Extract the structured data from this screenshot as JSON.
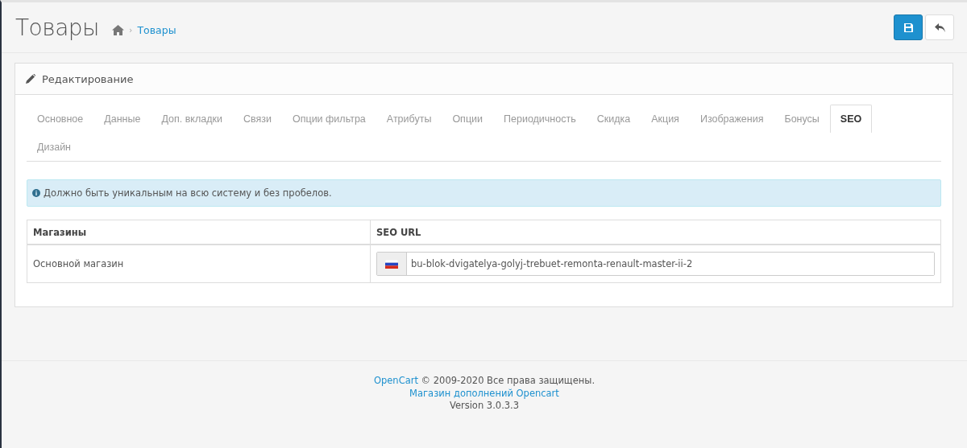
{
  "page": {
    "title": "Товары",
    "breadcrumb": [
      {
        "kind": "home"
      },
      {
        "kind": "link",
        "separator": "›",
        "label": "Товары"
      }
    ]
  },
  "actions": [
    {
      "kind": "save"
    },
    {
      "kind": "back"
    }
  ],
  "panel": {
    "title": "Редактирование",
    "tabs": [
      {
        "label": "Основное",
        "selected": false
      },
      {
        "label": "Данные",
        "selected": false
      },
      {
        "label": "Доп. вкладки",
        "selected": false
      },
      {
        "label": "Связи",
        "selected": false
      },
      {
        "label": "Опции фильтра",
        "selected": false
      },
      {
        "label": "Атрибуты",
        "selected": false
      },
      {
        "label": "Опции",
        "selected": false
      },
      {
        "label": "Периодичность",
        "selected": false
      },
      {
        "label": "Скидка",
        "selected": false
      },
      {
        "label": "Акция",
        "selected": false
      },
      {
        "label": "Изображения",
        "selected": false
      },
      {
        "label": "Бонусы",
        "selected": false
      },
      {
        "label": "SEO",
        "selected": true
      },
      {
        "label": "Дизайн",
        "selected": false
      }
    ],
    "alert": "Должно быть уникальным на всю систему и без пробелов.",
    "table": {
      "columns": [
        "Магазины",
        "SEO URL"
      ],
      "rows": [
        {
          "store": "Основной магазин",
          "seo_url": "bu-blok-dvigatelya-golyj-trebuet-remonta-renault-master-ii-2"
        }
      ]
    }
  },
  "footer": {
    "link": "OpenCart",
    "copyright": "© 2009-2020 Все права защищены.",
    "store_link": "Магазин дополнений Opencart",
    "version": "Version 3.0.3.3"
  }
}
